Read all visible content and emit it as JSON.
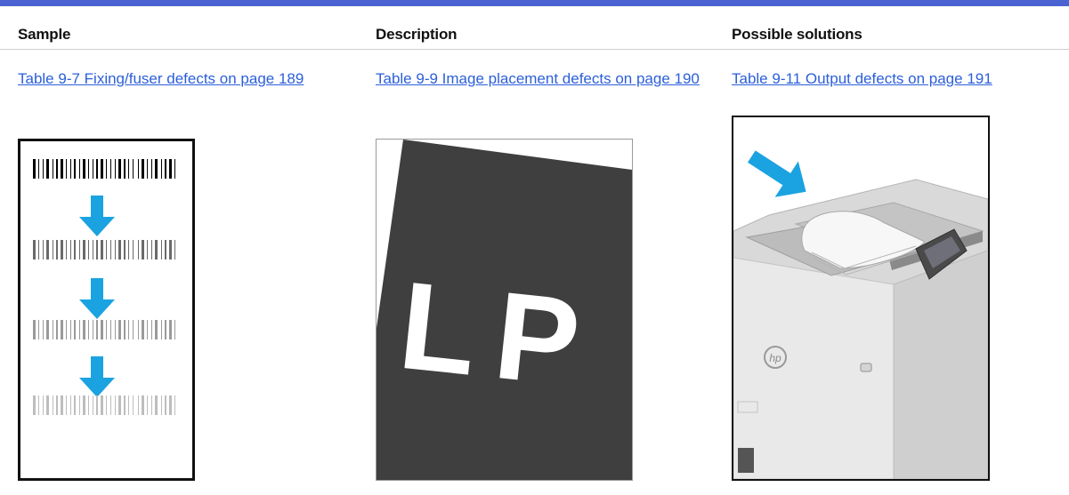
{
  "colors": {
    "accent": "#4b62d2",
    "link": "#2b5fd9",
    "arrow": "#1aa3e0",
    "dark_fill": "#3f3f3f"
  },
  "table": {
    "headers": [
      "Sample",
      "Description",
      "Possible solutions"
    ],
    "links": [
      "Table 9-7 Fixing/fuser defects on page 189",
      "Table 9-9 Image placement defects on page 190",
      "Table 9-11 Output defects on page 191"
    ]
  },
  "sample_image": {
    "barcode_strips": 4,
    "arrows": 3,
    "arrow_icon": "arrow-down-icon"
  },
  "placement_image": {
    "letters": "LP"
  },
  "printer_image": {
    "brand_mark": "hp",
    "arrow_icon": "arrow-down-right-icon"
  }
}
